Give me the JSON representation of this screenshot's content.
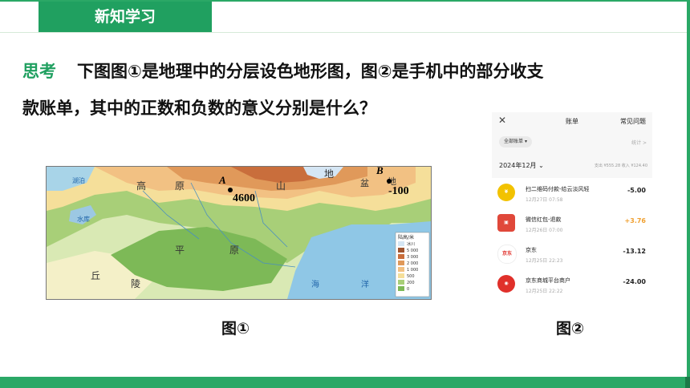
{
  "header": {
    "tag": "新知学习"
  },
  "question": {
    "keyword": "思考",
    "line1": "下图图①是地理中的分层设色地形图，图②是手机中的部分收支",
    "line2": "款账单，其中的正数和负数的意义分别是什么？"
  },
  "figure1": {
    "caption": "图①",
    "labels": {
      "lake": "湖泊",
      "reservoir": "水库",
      "plateau_1": "高",
      "plateau_2": "原",
      "mountain": "山",
      "basin_1": "地",
      "basin_2": "盆",
      "basin_3": "地",
      "plain_1": "平",
      "plain_2": "原",
      "hills_1": "丘",
      "hills_2": "陵",
      "sea_1": "海",
      "sea_2": "洋"
    },
    "point_a": {
      "label": "A",
      "value": "4600"
    },
    "point_b": {
      "label": "B",
      "value": "-100"
    },
    "legend": {
      "title": "陆高/米",
      "items": [
        "冰川",
        "5 000",
        "3 000",
        "2 000",
        "1 000",
        "500",
        "200",
        "0"
      ]
    }
  },
  "figure2": {
    "caption": "图②",
    "title": "账单",
    "faq": "常见问题",
    "filter": "全部账单",
    "stats": "统计 >",
    "month": "2024年12月",
    "summary": "支出 ¥555.28  收入 ¥124.40",
    "transactions": [
      {
        "name": "扫二维码付款-给云淡风轻",
        "time": "12月27日 07:58",
        "amount": "-5.00",
        "icon": "money-bag-icon"
      },
      {
        "name": "微信红包-退款",
        "time": "12月26日 07:00",
        "amount": "+3.76",
        "icon": "red-envelope-icon"
      },
      {
        "name": "京东",
        "time": "12月25日 22:23",
        "amount": "-13.12",
        "icon": "jd-logo-icon",
        "icon_text": "京东"
      },
      {
        "name": "京东商城平台商户",
        "time": "12月25日 22:22",
        "amount": "-24.00",
        "icon": "jd-store-icon"
      }
    ]
  },
  "colors": {
    "accent": "#20a060",
    "positive": "#f0a030"
  }
}
